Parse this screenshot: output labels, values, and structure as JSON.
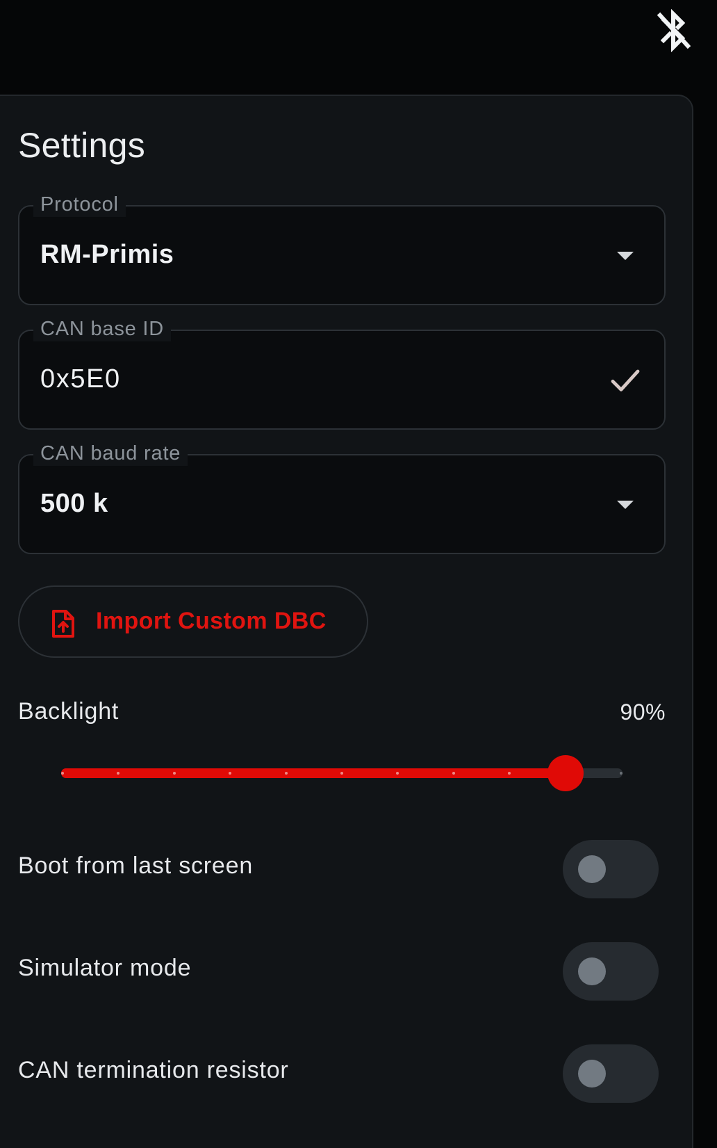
{
  "status_bar": {
    "bluetooth_icon": "bluetooth-disabled-icon"
  },
  "settings": {
    "title": "Settings",
    "protocol": {
      "label": "Protocol",
      "value": "RM-Primis",
      "trailing_icon": "dropdown-arrow-icon"
    },
    "can_base_id": {
      "label": "CAN base ID",
      "value": "0x5E0",
      "trailing_icon": "check-icon"
    },
    "can_baud_rate": {
      "label": "CAN baud rate",
      "value": "500 k",
      "trailing_icon": "dropdown-arrow-icon"
    },
    "import_button": {
      "label": "Import Custom DBC",
      "icon": "file-upload-icon"
    },
    "backlight": {
      "label": "Backlight",
      "value_text": "90%",
      "level": 0.9,
      "ticks": 10
    },
    "toggles": [
      {
        "label": "Boot from last screen",
        "on": false
      },
      {
        "label": "Simulator mode",
        "on": false
      },
      {
        "label": "CAN termination resistor",
        "on": false
      }
    ]
  },
  "colors": {
    "accent": "#e00a06",
    "background": "#050607",
    "panel": "#111417",
    "field_border": "#2c3136",
    "switch_track_off": "#262b30",
    "switch_thumb_off": "#727a82"
  }
}
